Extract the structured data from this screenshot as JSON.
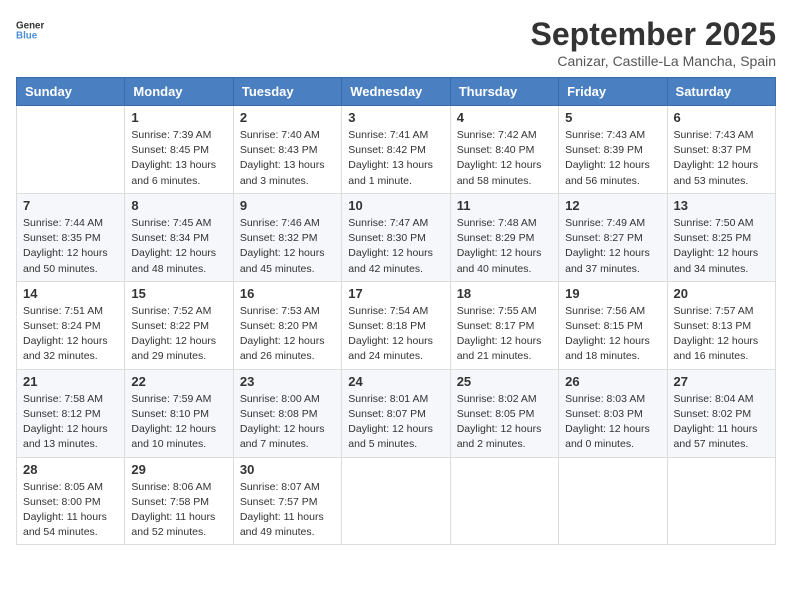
{
  "logo": {
    "text_general": "General",
    "text_blue": "Blue"
  },
  "title": "September 2025",
  "location": "Canizar, Castille-La Mancha, Spain",
  "days_of_week": [
    "Sunday",
    "Monday",
    "Tuesday",
    "Wednesday",
    "Thursday",
    "Friday",
    "Saturday"
  ],
  "weeks": [
    [
      {
        "day": "",
        "info": ""
      },
      {
        "day": "1",
        "info": "Sunrise: 7:39 AM\nSunset: 8:45 PM\nDaylight: 13 hours\nand 6 minutes."
      },
      {
        "day": "2",
        "info": "Sunrise: 7:40 AM\nSunset: 8:43 PM\nDaylight: 13 hours\nand 3 minutes."
      },
      {
        "day": "3",
        "info": "Sunrise: 7:41 AM\nSunset: 8:42 PM\nDaylight: 13 hours\nand 1 minute."
      },
      {
        "day": "4",
        "info": "Sunrise: 7:42 AM\nSunset: 8:40 PM\nDaylight: 12 hours\nand 58 minutes."
      },
      {
        "day": "5",
        "info": "Sunrise: 7:43 AM\nSunset: 8:39 PM\nDaylight: 12 hours\nand 56 minutes."
      },
      {
        "day": "6",
        "info": "Sunrise: 7:43 AM\nSunset: 8:37 PM\nDaylight: 12 hours\nand 53 minutes."
      }
    ],
    [
      {
        "day": "7",
        "info": "Sunrise: 7:44 AM\nSunset: 8:35 PM\nDaylight: 12 hours\nand 50 minutes."
      },
      {
        "day": "8",
        "info": "Sunrise: 7:45 AM\nSunset: 8:34 PM\nDaylight: 12 hours\nand 48 minutes."
      },
      {
        "day": "9",
        "info": "Sunrise: 7:46 AM\nSunset: 8:32 PM\nDaylight: 12 hours\nand 45 minutes."
      },
      {
        "day": "10",
        "info": "Sunrise: 7:47 AM\nSunset: 8:30 PM\nDaylight: 12 hours\nand 42 minutes."
      },
      {
        "day": "11",
        "info": "Sunrise: 7:48 AM\nSunset: 8:29 PM\nDaylight: 12 hours\nand 40 minutes."
      },
      {
        "day": "12",
        "info": "Sunrise: 7:49 AM\nSunset: 8:27 PM\nDaylight: 12 hours\nand 37 minutes."
      },
      {
        "day": "13",
        "info": "Sunrise: 7:50 AM\nSunset: 8:25 PM\nDaylight: 12 hours\nand 34 minutes."
      }
    ],
    [
      {
        "day": "14",
        "info": "Sunrise: 7:51 AM\nSunset: 8:24 PM\nDaylight: 12 hours\nand 32 minutes."
      },
      {
        "day": "15",
        "info": "Sunrise: 7:52 AM\nSunset: 8:22 PM\nDaylight: 12 hours\nand 29 minutes."
      },
      {
        "day": "16",
        "info": "Sunrise: 7:53 AM\nSunset: 8:20 PM\nDaylight: 12 hours\nand 26 minutes."
      },
      {
        "day": "17",
        "info": "Sunrise: 7:54 AM\nSunset: 8:18 PM\nDaylight: 12 hours\nand 24 minutes."
      },
      {
        "day": "18",
        "info": "Sunrise: 7:55 AM\nSunset: 8:17 PM\nDaylight: 12 hours\nand 21 minutes."
      },
      {
        "day": "19",
        "info": "Sunrise: 7:56 AM\nSunset: 8:15 PM\nDaylight: 12 hours\nand 18 minutes."
      },
      {
        "day": "20",
        "info": "Sunrise: 7:57 AM\nSunset: 8:13 PM\nDaylight: 12 hours\nand 16 minutes."
      }
    ],
    [
      {
        "day": "21",
        "info": "Sunrise: 7:58 AM\nSunset: 8:12 PM\nDaylight: 12 hours\nand 13 minutes."
      },
      {
        "day": "22",
        "info": "Sunrise: 7:59 AM\nSunset: 8:10 PM\nDaylight: 12 hours\nand 10 minutes."
      },
      {
        "day": "23",
        "info": "Sunrise: 8:00 AM\nSunset: 8:08 PM\nDaylight: 12 hours\nand 7 minutes."
      },
      {
        "day": "24",
        "info": "Sunrise: 8:01 AM\nSunset: 8:07 PM\nDaylight: 12 hours\nand 5 minutes."
      },
      {
        "day": "25",
        "info": "Sunrise: 8:02 AM\nSunset: 8:05 PM\nDaylight: 12 hours\nand 2 minutes."
      },
      {
        "day": "26",
        "info": "Sunrise: 8:03 AM\nSunset: 8:03 PM\nDaylight: 12 hours\nand 0 minutes."
      },
      {
        "day": "27",
        "info": "Sunrise: 8:04 AM\nSunset: 8:02 PM\nDaylight: 11 hours\nand 57 minutes."
      }
    ],
    [
      {
        "day": "28",
        "info": "Sunrise: 8:05 AM\nSunset: 8:00 PM\nDaylight: 11 hours\nand 54 minutes."
      },
      {
        "day": "29",
        "info": "Sunrise: 8:06 AM\nSunset: 7:58 PM\nDaylight: 11 hours\nand 52 minutes."
      },
      {
        "day": "30",
        "info": "Sunrise: 8:07 AM\nSunset: 7:57 PM\nDaylight: 11 hours\nand 49 minutes."
      },
      {
        "day": "",
        "info": ""
      },
      {
        "day": "",
        "info": ""
      },
      {
        "day": "",
        "info": ""
      },
      {
        "day": "",
        "info": ""
      }
    ]
  ]
}
